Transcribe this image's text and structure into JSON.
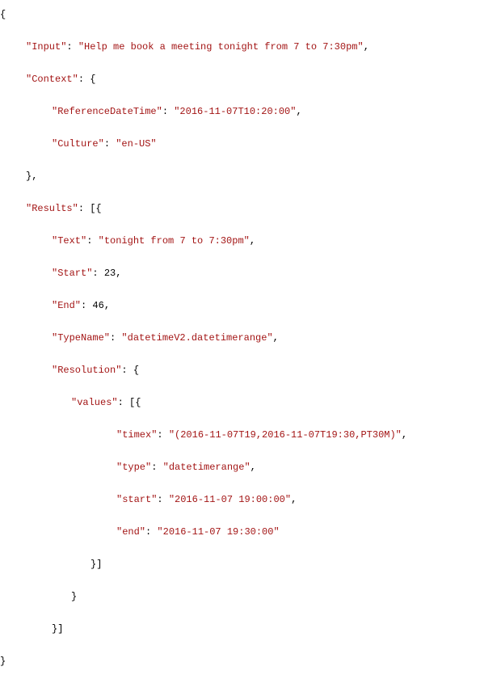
{
  "keys": {
    "input": "\"Input\"",
    "context": "\"Context\"",
    "refdt": "\"ReferenceDateTime\"",
    "culture": "\"Culture\"",
    "results": "\"Results\"",
    "text": "\"Text\"",
    "start": "\"Start\"",
    "end": "\"End\"",
    "typename": "\"TypeName\"",
    "resolution": "\"Resolution\"",
    "values": "\"values\"",
    "timex": "\"timex\"",
    "type": "\"type\"",
    "vstart": "\"start\"",
    "vend": "\"end\""
  },
  "vals": {
    "input": "\"Help me book a meeting tonight from 7 to 7:30pm\"",
    "refdt": "\"2016-11-07T10:20:00\"",
    "culture": "\"en-US\"",
    "text": "\"tonight from 7 to 7:30pm\"",
    "start": "23",
    "end": "46",
    "typename": "\"datetimeV2.datetimerange\"",
    "timex": "\"(2016-11-07T19,2016-11-07T19:30,PT30M)\"",
    "type": "\"datetimerange\"",
    "vstart": "\"2016-11-07 19:00:00\"",
    "vend": "\"2016-11-07 19:30:00\""
  }
}
